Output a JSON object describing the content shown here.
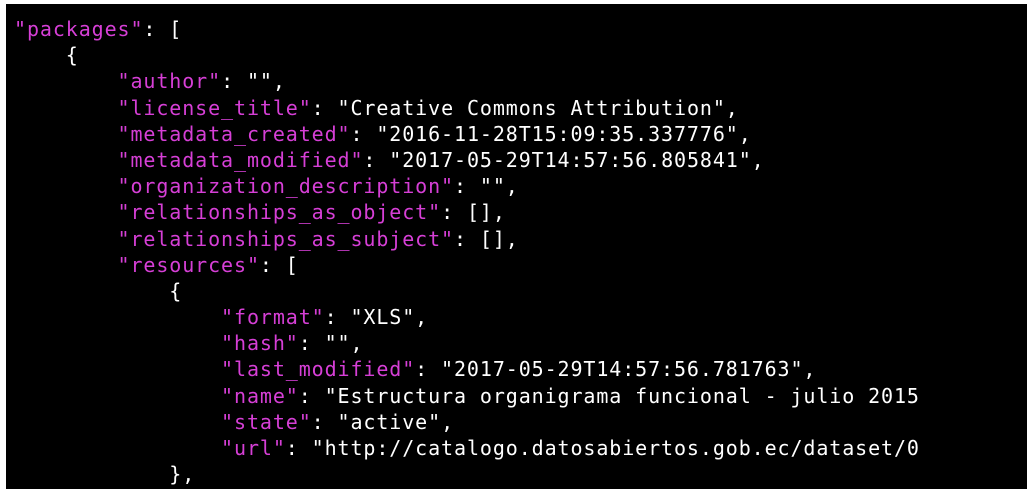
{
  "colors": {
    "background": "#000000",
    "key": "#d63fd6",
    "string": "#dd55dd",
    "punctuation": "#ffffff"
  },
  "lines": [
    [
      "\"packages\"",
      ": ["
    ],
    [
      "    {",
      ""
    ],
    [
      "        \"author\"",
      ": \"\","
    ],
    [
      "        \"license_title\"",
      ": \"Creative Commons Attribution\","
    ],
    [
      "        \"metadata_created\"",
      ": \"2016-11-28T15:09:35.337776\","
    ],
    [
      "        \"metadata_modified\"",
      ": \"2017-05-29T14:57:56.805841\","
    ],
    [
      "        \"organization_description\"",
      ": \"\","
    ],
    [
      "        \"relationships_as_object\"",
      ": [],"
    ],
    [
      "        \"relationships_as_subject\"",
      ": [],"
    ],
    [
      "        \"resources\"",
      ": ["
    ],
    [
      "            {",
      ""
    ],
    [
      "                \"format\"",
      ": \"XLS\","
    ],
    [
      "                \"hash\"",
      ": \"\","
    ],
    [
      "                \"last_modified\"",
      ": \"2017-05-29T14:57:56.781763\","
    ],
    [
      "                \"name\"",
      ": \"Estructura organigrama funcional - julio 2015"
    ],
    [
      "                \"state\"",
      ": \"active\","
    ],
    [
      "                \"url\"",
      ": \"http://catalogo.datosabiertos.gob.ec/dataset/0"
    ],
    [
      "            },",
      ""
    ]
  ]
}
